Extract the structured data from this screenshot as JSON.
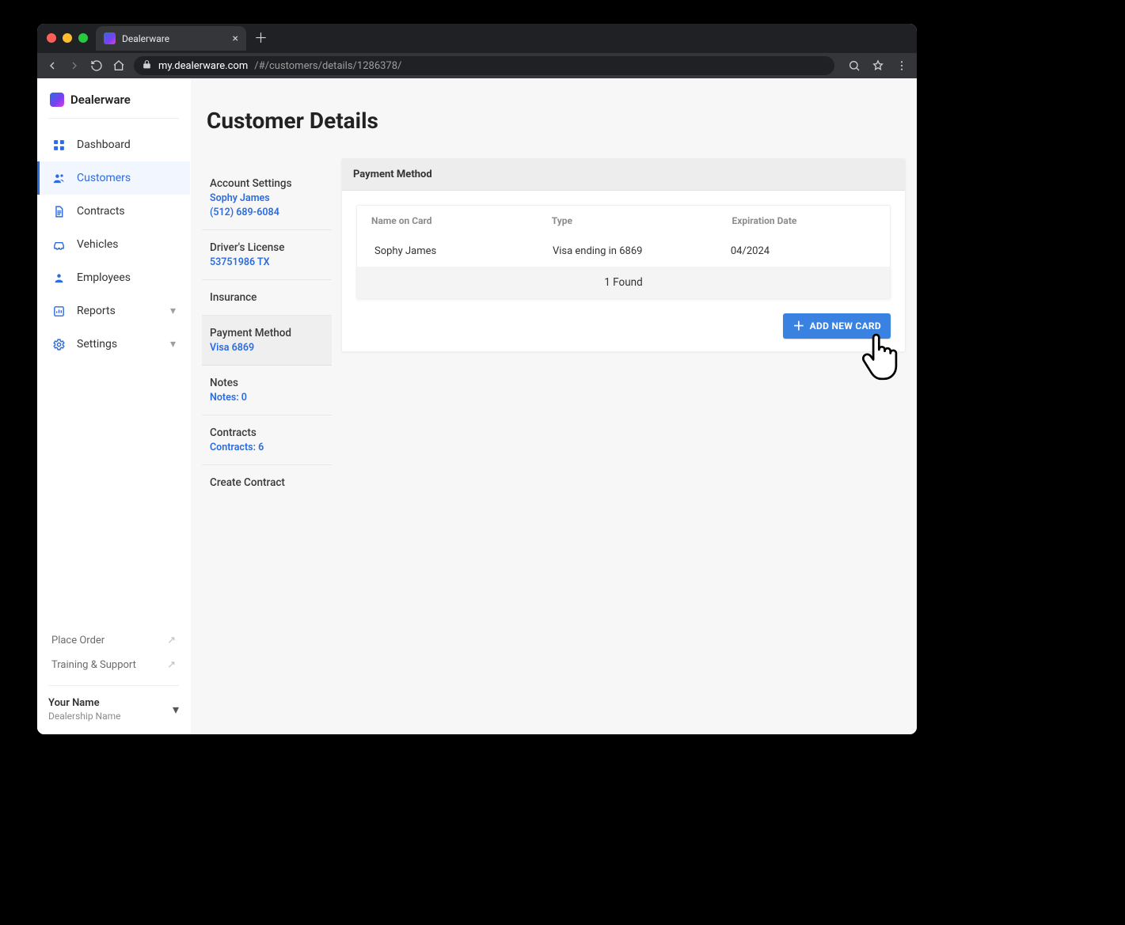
{
  "browser": {
    "tab_title": "Dealerware",
    "url_host": "my.dealerware.com",
    "url_path": "/#/customers/details/1286378/"
  },
  "brand": {
    "name": "Dealerware"
  },
  "nav": {
    "dashboard": "Dashboard",
    "customers": "Customers",
    "contracts": "Contracts",
    "vehicles": "Vehicles",
    "employees": "Employees",
    "reports": "Reports",
    "settings": "Settings"
  },
  "sidebar_links": {
    "place_order": "Place Order",
    "training": "Training & Support"
  },
  "account": {
    "name": "Your Name",
    "dealer": "Dealership Name"
  },
  "page": {
    "title": "Customer Details"
  },
  "subnav": {
    "account": {
      "label": "Account Settings",
      "name": "Sophy James",
      "phone": "(512) 689-6084"
    },
    "license": {
      "label": "Driver's License",
      "num": "53751986 TX"
    },
    "insurance": {
      "label": "Insurance"
    },
    "payment": {
      "label": "Payment Method",
      "detail": "Visa 6869"
    },
    "notes": {
      "label": "Notes",
      "detail": "Notes: 0"
    },
    "contracts": {
      "label": "Contracts",
      "detail": "Contracts: 6"
    },
    "create": {
      "label": "Create Contract"
    }
  },
  "panel": {
    "title": "Payment Method",
    "columns": {
      "name": "Name on Card",
      "type": "Type",
      "exp": "Expiration Date"
    },
    "row": {
      "name": "Sophy James",
      "type": "Visa ending in 6869",
      "exp": "04/2024"
    },
    "found": "1 Found",
    "add_label": "ADD NEW CARD"
  }
}
